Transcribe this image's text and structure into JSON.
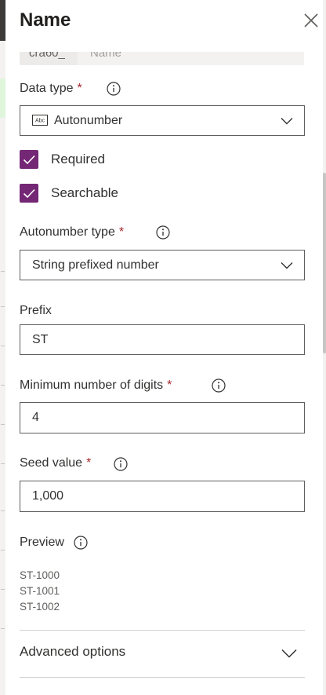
{
  "panel": {
    "title": "Name",
    "close_icon": "close-icon"
  },
  "name_field": {
    "prefix": "cra60_",
    "placeholder": "Name"
  },
  "data_type": {
    "label": "Data type",
    "required_marker": "*",
    "selected": "Autonumber",
    "icon": "text-abc-icon"
  },
  "checkboxes": [
    {
      "label": "Required",
      "checked": true
    },
    {
      "label": "Searchable",
      "checked": true
    }
  ],
  "autonumber_type": {
    "label": "Autonumber type",
    "required_marker": "*",
    "selected": "String prefixed number"
  },
  "prefix": {
    "label": "Prefix",
    "value": "ST"
  },
  "min_digits": {
    "label": "Minimum number of digits",
    "required_marker": "*",
    "value": "4"
  },
  "seed_value": {
    "label": "Seed value",
    "required_marker": "*",
    "value": "1,000"
  },
  "preview": {
    "label": "Preview",
    "lines": [
      "ST-1000",
      "ST-1001",
      "ST-1002"
    ]
  },
  "advanced": {
    "label": "Advanced options"
  },
  "colors": {
    "accent": "#742774",
    "required": "#a4262c",
    "border": "#605e5c"
  }
}
